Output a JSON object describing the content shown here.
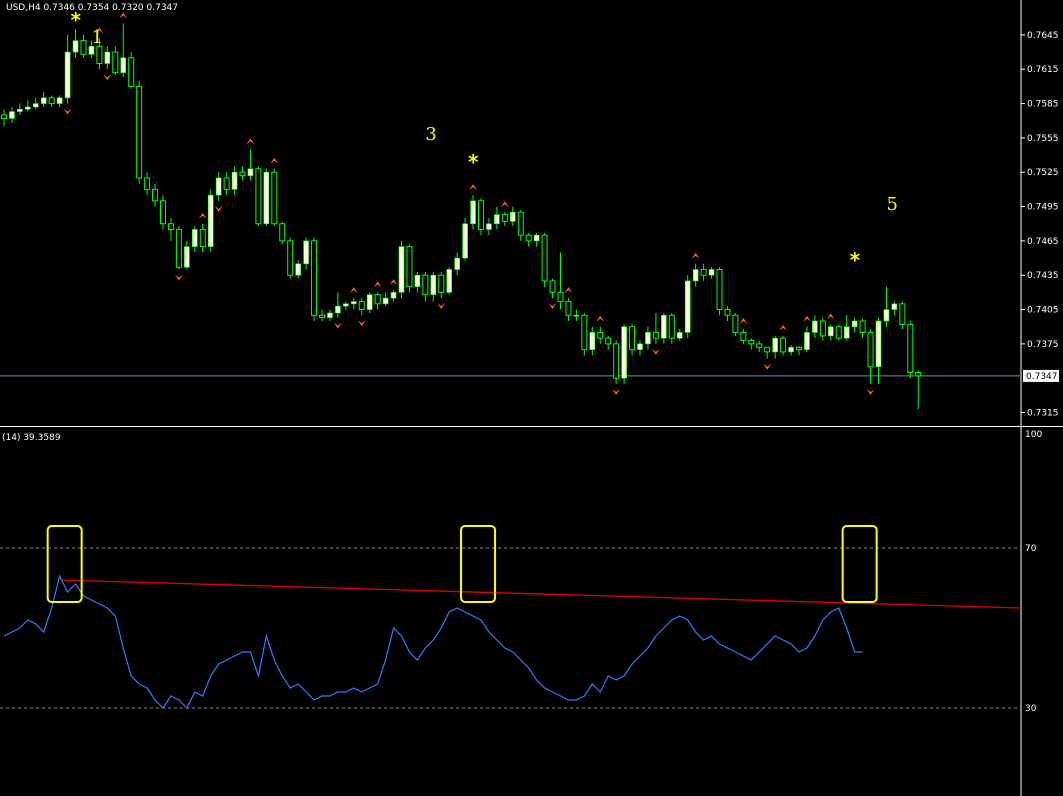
{
  "header": {
    "symbol_text": "USD,H4  0.7346 0.7354 0.7320 0.7347",
    "indicator_text": "(14) 39.3589"
  },
  "colors": {
    "background": "#000000",
    "bull_candle": "#ffffe0",
    "candle_wick": "#00ff00",
    "fractal_arrow": "#ff5a3c",
    "indicator_line": "#2a7fff",
    "trend_line": "#e00000",
    "highlight": "#ffff00",
    "grid_line": "#8c8c8c",
    "axis": "#ffffff"
  },
  "wave_labels": [
    {
      "text": "1",
      "index": 11,
      "price": 0.7638
    },
    {
      "text": "3",
      "index": 53,
      "price": 0.7553
    },
    {
      "text": "5",
      "index": 111,
      "price": 0.7492
    }
  ],
  "star_labels": [
    {
      "text": "*",
      "index": 9,
      "price": 0.7652
    },
    {
      "text": "*",
      "index": 59,
      "price": 0.7528
    },
    {
      "text": "*",
      "index": 107,
      "price": 0.7442
    }
  ],
  "chart_data": [
    {
      "type": "candlestick",
      "ylim": [
        0.7305,
        0.7665
      ],
      "y_ticks": [
        "0.7645",
        "0.7615",
        "0.7585",
        "0.7555",
        "0.7525",
        "0.7495",
        "0.7465",
        "0.7435",
        "0.7405",
        "0.7375",
        "0.7315"
      ],
      "current_price": "0.7347",
      "current_price_value": 0.7347,
      "close": [
        0.7572,
        0.7578,
        0.758,
        0.7582,
        0.7585,
        0.759,
        0.7585,
        0.759,
        0.763,
        0.764,
        0.7628,
        0.7635,
        0.762,
        0.763,
        0.7612,
        0.7625,
        0.76,
        0.752,
        0.751,
        0.75,
        0.748,
        0.7475,
        0.7442,
        0.746,
        0.7475,
        0.746,
        0.7505,
        0.752,
        0.751,
        0.7525,
        0.7522,
        0.7528,
        0.748,
        0.7525,
        0.748,
        0.7465,
        0.7435,
        0.7445,
        0.7465,
        0.74,
        0.7398,
        0.7402,
        0.7408,
        0.741,
        0.7412,
        0.7405,
        0.7418,
        0.741,
        0.7415,
        0.742,
        0.746,
        0.7425,
        0.7435,
        0.7418,
        0.7435,
        0.742,
        0.744,
        0.745,
        0.748,
        0.75,
        0.7475,
        0.748,
        0.7488,
        0.7482,
        0.749,
        0.747,
        0.7465,
        0.747,
        0.743,
        0.742,
        0.7412,
        0.74,
        0.74,
        0.737,
        0.7385,
        0.738,
        0.7375,
        0.7345,
        0.739,
        0.737,
        0.7375,
        0.7385,
        0.738,
        0.74,
        0.738,
        0.7385,
        0.743,
        0.744,
        0.7435,
        0.744,
        0.7405,
        0.74,
        0.7385,
        0.7378,
        0.7375,
        0.7372,
        0.7368,
        0.738,
        0.7368,
        0.7372,
        0.737,
        0.7385,
        0.7395,
        0.7382,
        0.739,
        0.738,
        0.739,
        0.7395,
        0.7385,
        0.7355,
        0.7395,
        0.7405,
        0.741,
        0.7392,
        0.735,
        0.7347
      ],
      "open": [
        0.7575,
        0.7572,
        0.7578,
        0.758,
        0.7582,
        0.7585,
        0.759,
        0.7585,
        0.759,
        0.763,
        0.764,
        0.7628,
        0.7635,
        0.762,
        0.763,
        0.7612,
        0.7625,
        0.76,
        0.752,
        0.751,
        0.75,
        0.748,
        0.7475,
        0.7442,
        0.746,
        0.7475,
        0.746,
        0.7505,
        0.752,
        0.751,
        0.7525,
        0.7522,
        0.7528,
        0.748,
        0.7525,
        0.748,
        0.7465,
        0.7435,
        0.7445,
        0.7465,
        0.74,
        0.7398,
        0.7402,
        0.7408,
        0.741,
        0.7412,
        0.7405,
        0.7418,
        0.741,
        0.7415,
        0.742,
        0.746,
        0.7425,
        0.7435,
        0.7418,
        0.7435,
        0.742,
        0.744,
        0.745,
        0.748,
        0.75,
        0.7475,
        0.748,
        0.7488,
        0.7482,
        0.749,
        0.747,
        0.7465,
        0.747,
        0.743,
        0.742,
        0.7412,
        0.74,
        0.74,
        0.737,
        0.7385,
        0.738,
        0.7375,
        0.7345,
        0.739,
        0.737,
        0.7375,
        0.7385,
        0.738,
        0.74,
        0.738,
        0.7385,
        0.743,
        0.744,
        0.7435,
        0.744,
        0.7405,
        0.74,
        0.7385,
        0.7378,
        0.7375,
        0.7372,
        0.7368,
        0.738,
        0.7368,
        0.7372,
        0.737,
        0.7385,
        0.7395,
        0.7382,
        0.739,
        0.738,
        0.739,
        0.7395,
        0.7385,
        0.7355,
        0.7395,
        0.7405,
        0.741,
        0.7392,
        0.735
      ],
      "high": [
        0.758,
        0.7582,
        0.7585,
        0.7588,
        0.759,
        0.7595,
        0.7592,
        0.7592,
        0.7645,
        0.765,
        0.7645,
        0.764,
        0.7642,
        0.7635,
        0.7635,
        0.7655,
        0.763,
        0.7605,
        0.7525,
        0.7515,
        0.7505,
        0.7485,
        0.7478,
        0.7465,
        0.7478,
        0.748,
        0.751,
        0.7525,
        0.7525,
        0.753,
        0.753,
        0.7545,
        0.753,
        0.7528,
        0.7528,
        0.7482,
        0.7468,
        0.7448,
        0.7468,
        0.7468,
        0.7405,
        0.7405,
        0.742,
        0.7412,
        0.7415,
        0.7415,
        0.742,
        0.742,
        0.742,
        0.7422,
        0.7465,
        0.7462,
        0.7438,
        0.7438,
        0.7438,
        0.7438,
        0.7442,
        0.7455,
        0.7485,
        0.7505,
        0.7502,
        0.7485,
        0.7495,
        0.749,
        0.7495,
        0.7492,
        0.7472,
        0.7472,
        0.7472,
        0.7432,
        0.7455,
        0.7415,
        0.7405,
        0.7402,
        0.739,
        0.739,
        0.7382,
        0.7378,
        0.7392,
        0.7392,
        0.7378,
        0.739,
        0.7402,
        0.7402,
        0.7402,
        0.7388,
        0.7435,
        0.7445,
        0.7445,
        0.7442,
        0.7442,
        0.7408,
        0.7402,
        0.7388,
        0.738,
        0.7378,
        0.7372,
        0.7382,
        0.7382,
        0.7374,
        0.7373,
        0.739,
        0.74,
        0.7398,
        0.7392,
        0.7392,
        0.74,
        0.7398,
        0.7397,
        0.7388,
        0.7398,
        0.7425,
        0.7412,
        0.7412,
        0.7395,
        0.7352
      ],
      "low": [
        0.7565,
        0.7568,
        0.7575,
        0.7578,
        0.758,
        0.7582,
        0.7582,
        0.7582,
        0.7585,
        0.7625,
        0.7625,
        0.7625,
        0.7615,
        0.7615,
        0.761,
        0.7608,
        0.7598,
        0.7515,
        0.7505,
        0.7495,
        0.7475,
        0.7465,
        0.744,
        0.744,
        0.7455,
        0.7455,
        0.7455,
        0.75,
        0.7505,
        0.7505,
        0.7518,
        0.7518,
        0.7478,
        0.7478,
        0.7478,
        0.7462,
        0.7432,
        0.7432,
        0.744,
        0.7395,
        0.7395,
        0.7395,
        0.7398,
        0.7405,
        0.7405,
        0.74,
        0.7402,
        0.7405,
        0.7408,
        0.7412,
        0.7415,
        0.742,
        0.742,
        0.7412,
        0.7412,
        0.7415,
        0.7418,
        0.7435,
        0.7448,
        0.7475,
        0.747,
        0.747,
        0.7475,
        0.7478,
        0.7478,
        0.7465,
        0.746,
        0.746,
        0.7425,
        0.7415,
        0.7405,
        0.7395,
        0.7395,
        0.7365,
        0.7365,
        0.7375,
        0.737,
        0.734,
        0.734,
        0.7365,
        0.7365,
        0.737,
        0.7375,
        0.7375,
        0.7375,
        0.7378,
        0.738,
        0.7425,
        0.743,
        0.7432,
        0.74,
        0.7395,
        0.7382,
        0.7375,
        0.737,
        0.7368,
        0.7362,
        0.7362,
        0.7365,
        0.7365,
        0.7365,
        0.7368,
        0.738,
        0.7378,
        0.7378,
        0.7378,
        0.7378,
        0.7385,
        0.738,
        0.734,
        0.734,
        0.739,
        0.74,
        0.7388,
        0.7345,
        0.7318
      ],
      "fractal_up_indices": [
        12,
        15,
        25,
        31,
        34,
        44,
        47,
        49,
        59,
        63,
        71,
        75,
        87,
        93,
        98,
        101,
        104
      ],
      "fractal_down_indices": [
        8,
        13,
        22,
        27,
        42,
        45,
        55,
        69,
        77,
        82,
        96,
        109
      ]
    },
    {
      "type": "line",
      "ylim": [
        0,
        100
      ],
      "y_ticks": [
        "100",
        "70",
        "30"
      ],
      "levels": [
        70,
        30
      ],
      "series": [
        {
          "values": [
            48,
            49,
            50,
            52,
            51,
            49,
            55,
            63,
            59,
            61,
            58,
            57,
            56,
            55,
            53,
            45,
            38,
            36,
            35,
            32,
            30,
            33,
            32,
            30,
            34,
            33,
            38,
            41,
            42,
            43,
            44,
            44,
            38,
            48,
            42,
            38,
            35,
            36,
            34,
            32,
            33,
            33,
            34,
            34,
            35,
            34,
            35,
            36,
            42,
            50,
            48,
            44,
            42,
            45,
            47,
            50,
            54,
            55,
            54,
            53,
            52,
            49,
            47,
            45,
            44,
            42,
            40,
            37,
            35,
            34,
            33,
            32,
            32,
            33,
            36,
            34,
            38,
            37,
            38,
            41,
            43,
            45,
            48,
            50,
            52,
            53,
            52,
            49,
            47,
            48,
            46,
            45,
            44,
            43,
            42,
            44,
            46,
            48,
            47,
            46,
            44,
            45,
            48,
            52,
            54,
            55,
            50,
            44,
            44
          ]
        }
      ],
      "trend_line": {
        "start_index": 7,
        "start_value": 62,
        "end_value": 55
      },
      "highlight_indices": [
        7,
        59,
        107
      ]
    }
  ]
}
